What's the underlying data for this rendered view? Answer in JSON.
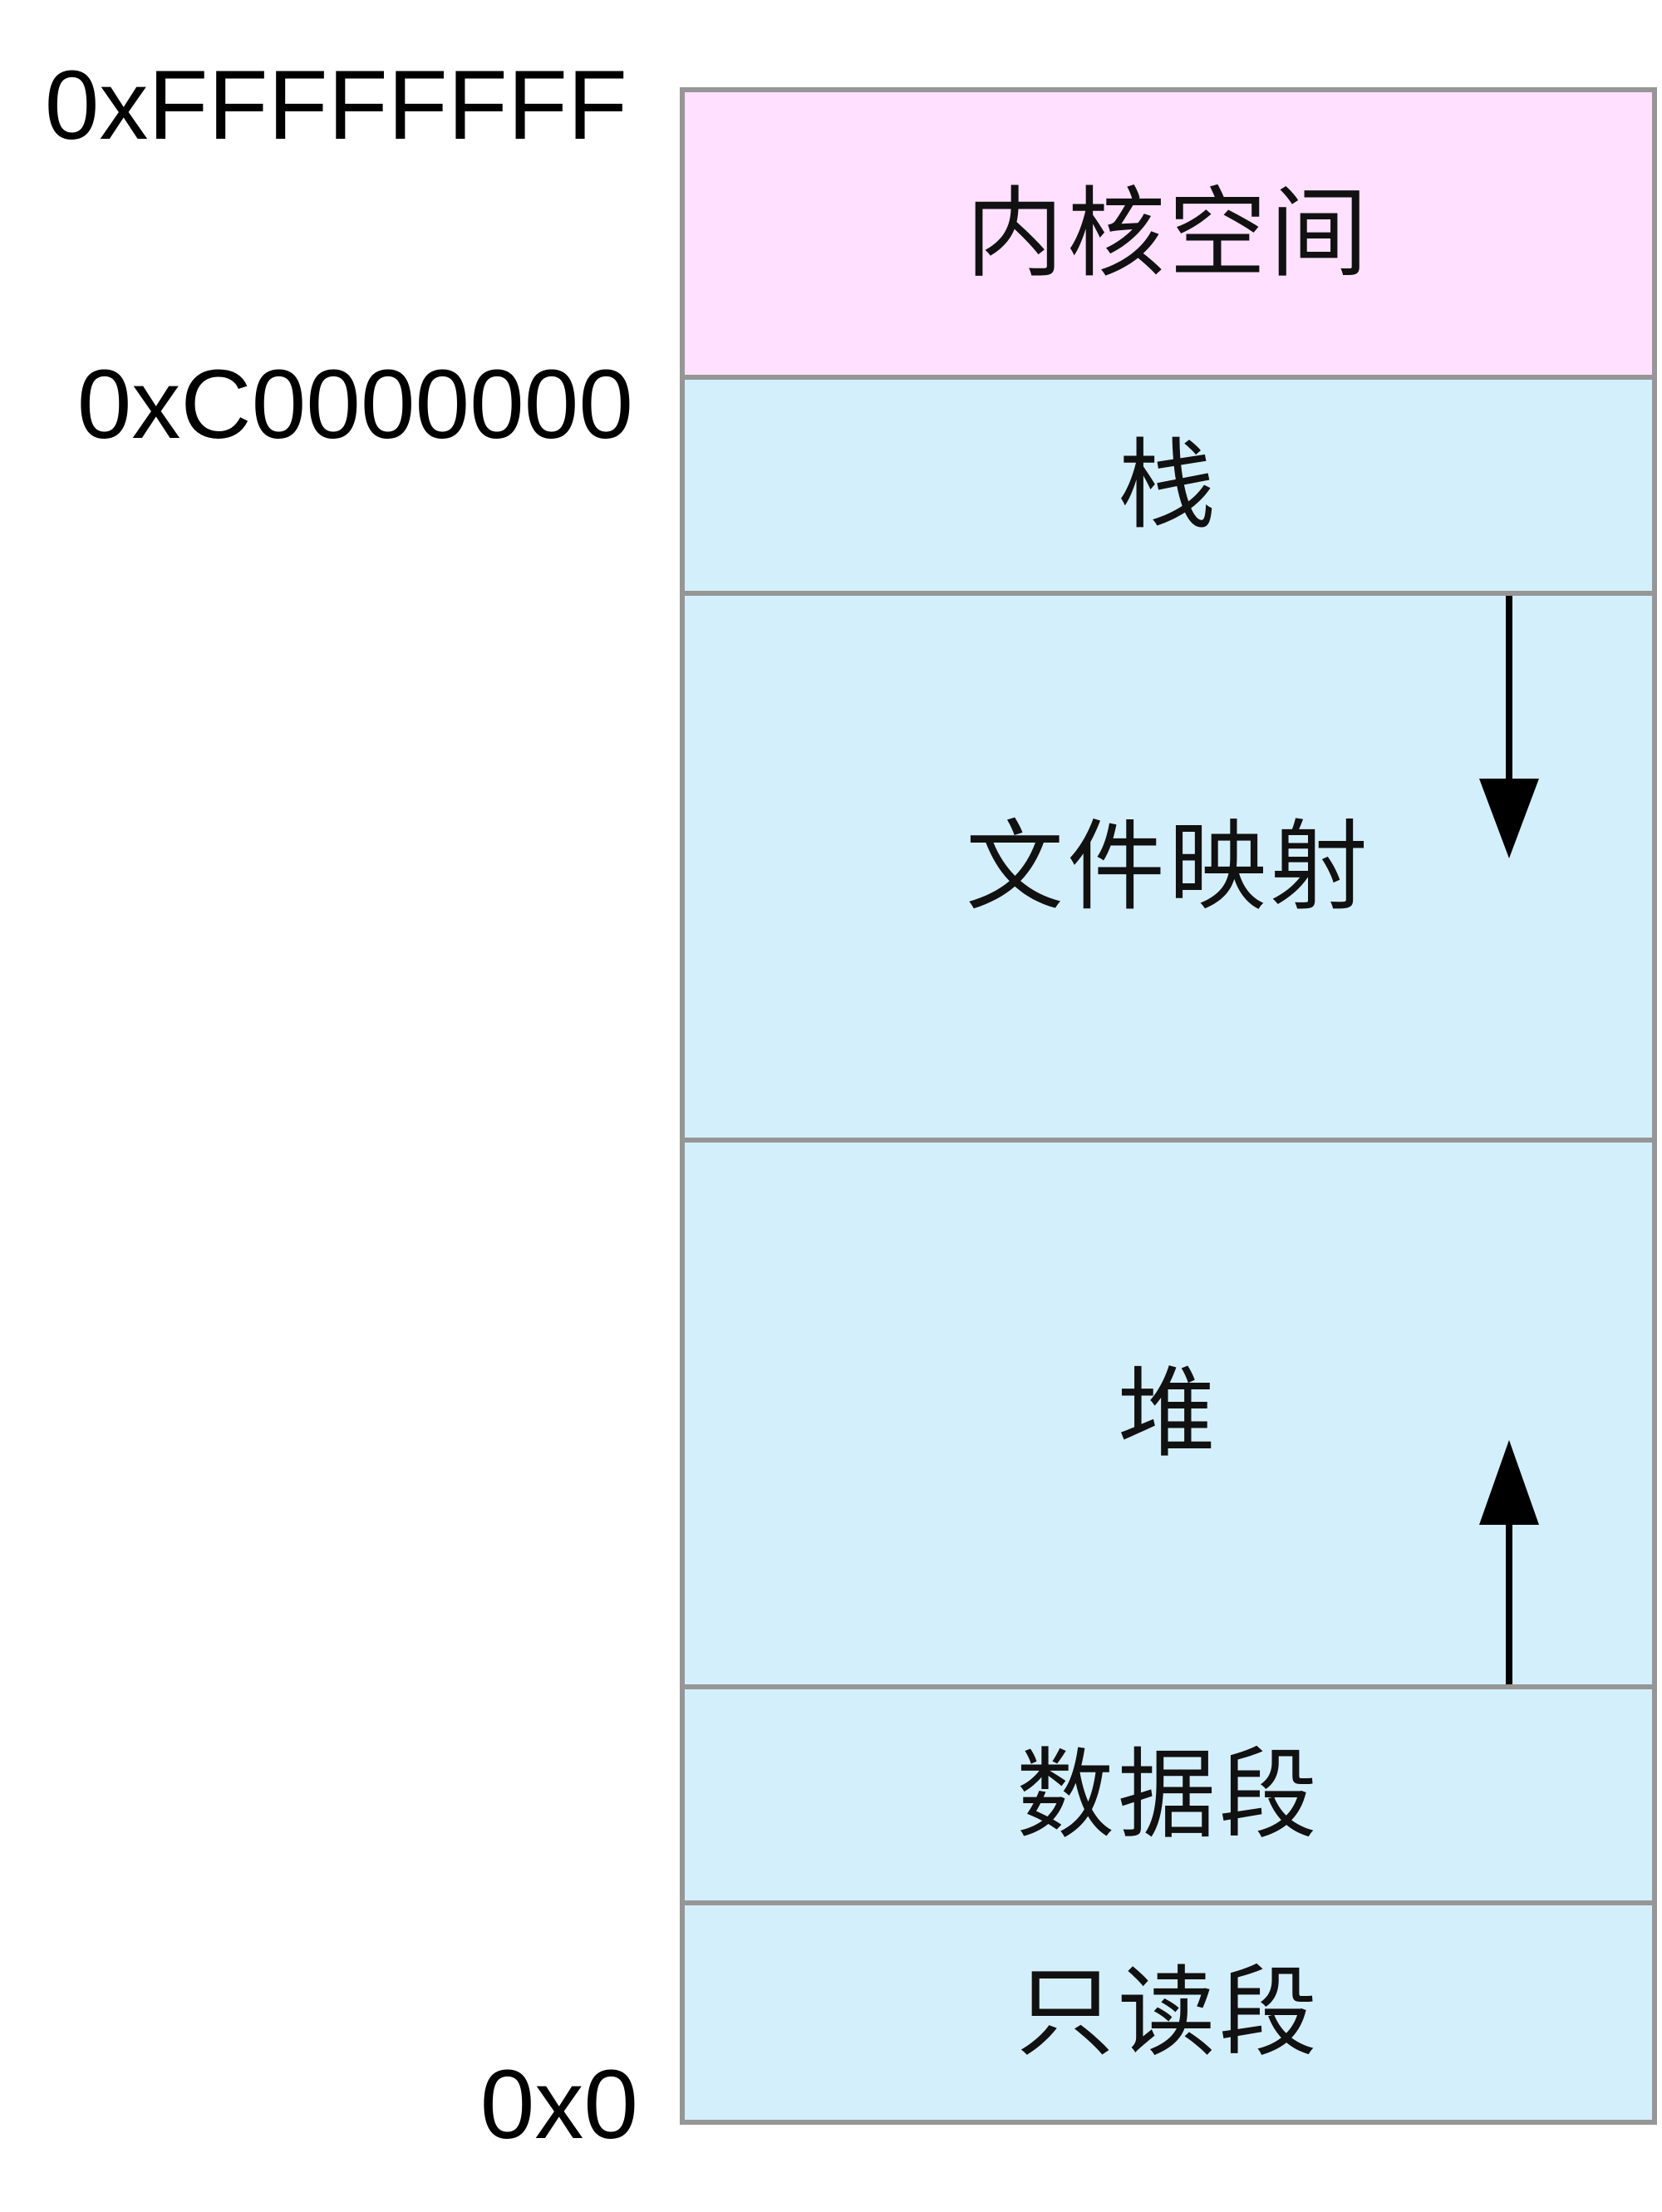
{
  "addresses": {
    "top": "0xFFFFFFFF",
    "kernel_boundary": "0xC0000000",
    "bottom": "0x0"
  },
  "segments": [
    {
      "label": "内核空间",
      "color": "#FFE0FF"
    },
    {
      "label": "栈",
      "color": "#D4EFFC"
    },
    {
      "label": "文件映射",
      "color": "#D4EFFC"
    },
    {
      "label": "堆",
      "color": "#D4EFFC"
    },
    {
      "label": "数据段",
      "color": "#D4EFFC"
    },
    {
      "label": "只读段",
      "color": "#D4EFFC"
    }
  ],
  "arrows": [
    {
      "segment": "文件映射",
      "direction": "down"
    },
    {
      "segment": "堆",
      "direction": "up"
    }
  ],
  "colors": {
    "border": "#969696",
    "arrow": "#000000"
  }
}
